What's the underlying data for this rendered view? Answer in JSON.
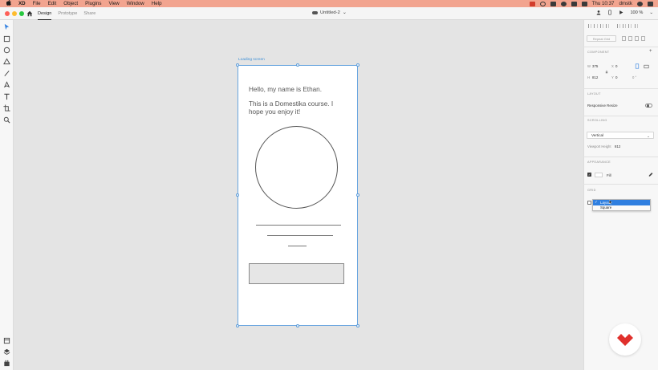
{
  "menubar": {
    "apple_glyph": "",
    "app_name": "XD",
    "items": [
      "File",
      "Edit",
      "Object",
      "Plugins",
      "View",
      "Window",
      "Help"
    ],
    "clock": "Thu 10:37",
    "user": "dmstk"
  },
  "titlebar": {
    "modes": [
      {
        "label": "Design",
        "active": true
      },
      {
        "label": "Prototype",
        "active": false
      },
      {
        "label": "Share",
        "active": false
      }
    ],
    "document_title": "Untitled-2",
    "zoom": "100 %"
  },
  "artboard": {
    "label": "Loading screen",
    "greeting": "Hello, my name is Ethan.",
    "intro": "This is a Domestika course. I hope you enjoy it!"
  },
  "panel": {
    "repeat_grid": "Repeat Grid",
    "component_title": "COMPONENT",
    "add_symbol": "+",
    "w_label": "W",
    "w_value": "375",
    "x_label": "X",
    "x_value": "0",
    "h_label": "H",
    "h_value": "812",
    "y_label": "Y",
    "y_value": "0",
    "rotation": "0 °",
    "layout_title": "LAYOUT",
    "responsive_label": "Responsive Resize",
    "responsive_on": false,
    "scrolling_title": "SCROLLING",
    "scrolling_value": "Vertical",
    "viewport_label": "Viewport Height",
    "viewport_value": "812",
    "appearance_title": "APPEARANCE",
    "fill_label": "Fill",
    "fill_checked": true,
    "fill_color": "#FFFFFF",
    "grid_title": "GRID",
    "grid_options": [
      {
        "label": "Layout",
        "selected": true
      },
      {
        "label": "Square",
        "selected": false
      }
    ]
  },
  "colors": {
    "menubar_bg": "#f2a48f",
    "accent_blue": "#2f7fe0",
    "artboard_border": "#6aa6e0",
    "brand_red": "#e0302c"
  }
}
